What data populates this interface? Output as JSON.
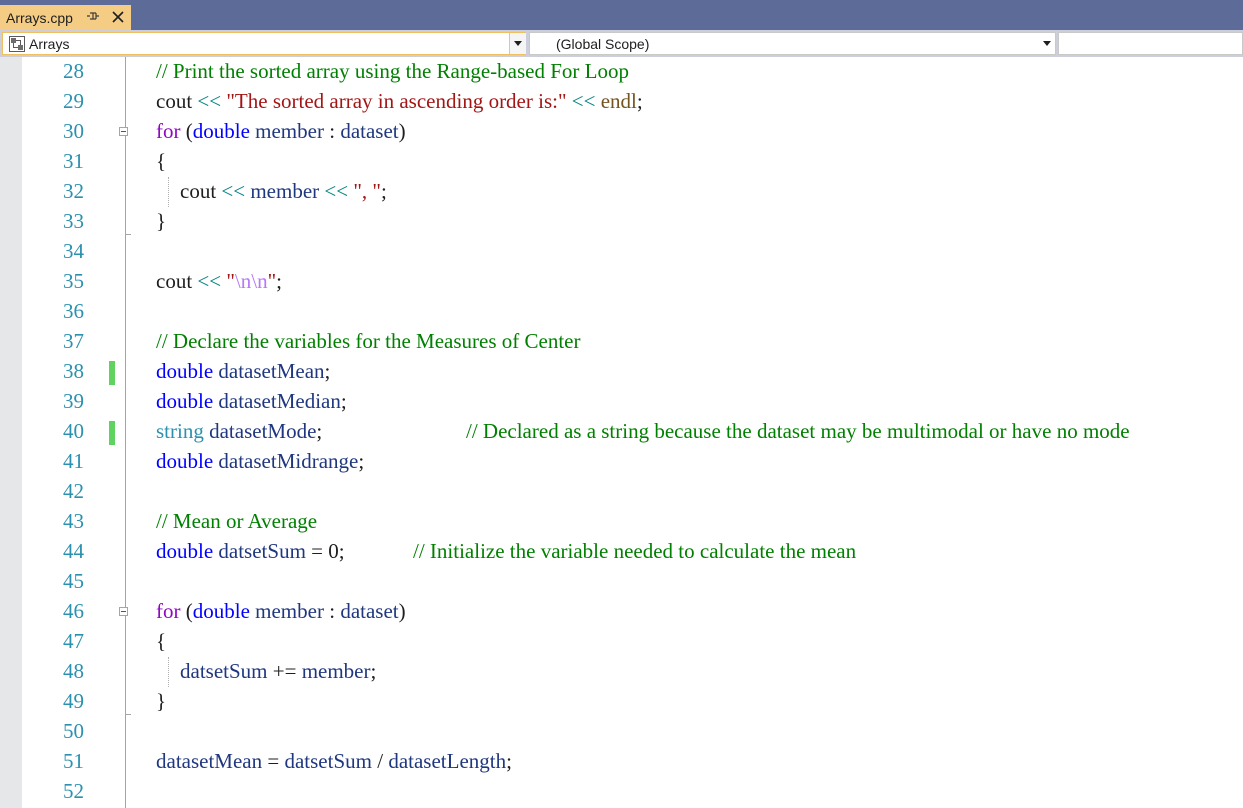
{
  "tab": {
    "title": "Arrays.cpp",
    "pin_icon": "pin-icon",
    "close_icon": "close-icon"
  },
  "nav": {
    "project_combo": "Arrays",
    "scope_combo": "(Global Scope)"
  },
  "colors": {
    "tab_active": "#f5cc84",
    "tab_strip": "#5d6b99",
    "line_number": "#2b91af",
    "keyword": "#0000ff",
    "flow_keyword": "#8f08c4",
    "comment": "#008000",
    "string": "#a31515",
    "change_marker": "#5fd25f"
  },
  "editor": {
    "line_numbers": [
      "28",
      "29",
      "30",
      "31",
      "32",
      "33",
      "34",
      "35",
      "36",
      "37",
      "38",
      "39",
      "40",
      "41",
      "42",
      "43",
      "44",
      "45",
      "46",
      "47",
      "48",
      "49",
      "50",
      "51",
      "52"
    ],
    "code": {
      "l28_comment": "// Print the sorted array using the Range-based For Loop",
      "l29_cout": "cout",
      "l29_op1": " << ",
      "l29_str": "\"The sorted array in ascending order is:\"",
      "l29_op2": " << ",
      "l29_endl": "endl",
      "l29_end": ";",
      "l30_for": "for",
      "l30_p1": " (",
      "l30_double": "double",
      "l30_member": " member",
      "l30_colon": " : ",
      "l30_dataset": "dataset",
      "l30_p2": ")",
      "l31": "{",
      "l32_cout": "cout",
      "l32_op1": " << ",
      "l32_member": "member",
      "l32_op2": " << ",
      "l32_str": "\", \"",
      "l32_end": ";",
      "l33": "}",
      "l35_cout": "cout",
      "l35_op": " << ",
      "l35_q1": "\"",
      "l35_esc": "\\n\\n",
      "l35_q2": "\"",
      "l35_end": ";",
      "l37_comment": "// Declare the variables for the Measures of Center",
      "l38_type": "double",
      "l38_name": " datasetMean",
      "l38_end": ";",
      "l39_type": "double",
      "l39_name": " datasetMedian",
      "l39_end": ";",
      "l40_type": "string",
      "l40_name": " datasetMode",
      "l40_end": ";",
      "l40_comment": "// Declared as a string because the dataset may be multimodal or have no mode",
      "l41_type": "double",
      "l41_name": " datasetMidrange",
      "l41_end": ";",
      "l43_comment": "// Mean or Average",
      "l44_type": "double",
      "l44_name": " datsetSum",
      "l44_rest": " = 0;",
      "l44_comment": "// Initialize the variable needed to calculate the mean",
      "l46_for": "for",
      "l46_p1": " (",
      "l46_double": "double",
      "l46_member": " member",
      "l46_colon": " : ",
      "l46_dataset": "dataset",
      "l46_p2": ")",
      "l47": "{",
      "l48_sum": "datsetSum",
      "l48_op": " += ",
      "l48_member": "member",
      "l48_end": ";",
      "l49": "}",
      "l51_mean": "datasetMean",
      "l51_eq": " = ",
      "l51_sum": "datsetSum",
      "l51_div": " / ",
      "l51_len": "datasetLength",
      "l51_end": ";"
    }
  }
}
